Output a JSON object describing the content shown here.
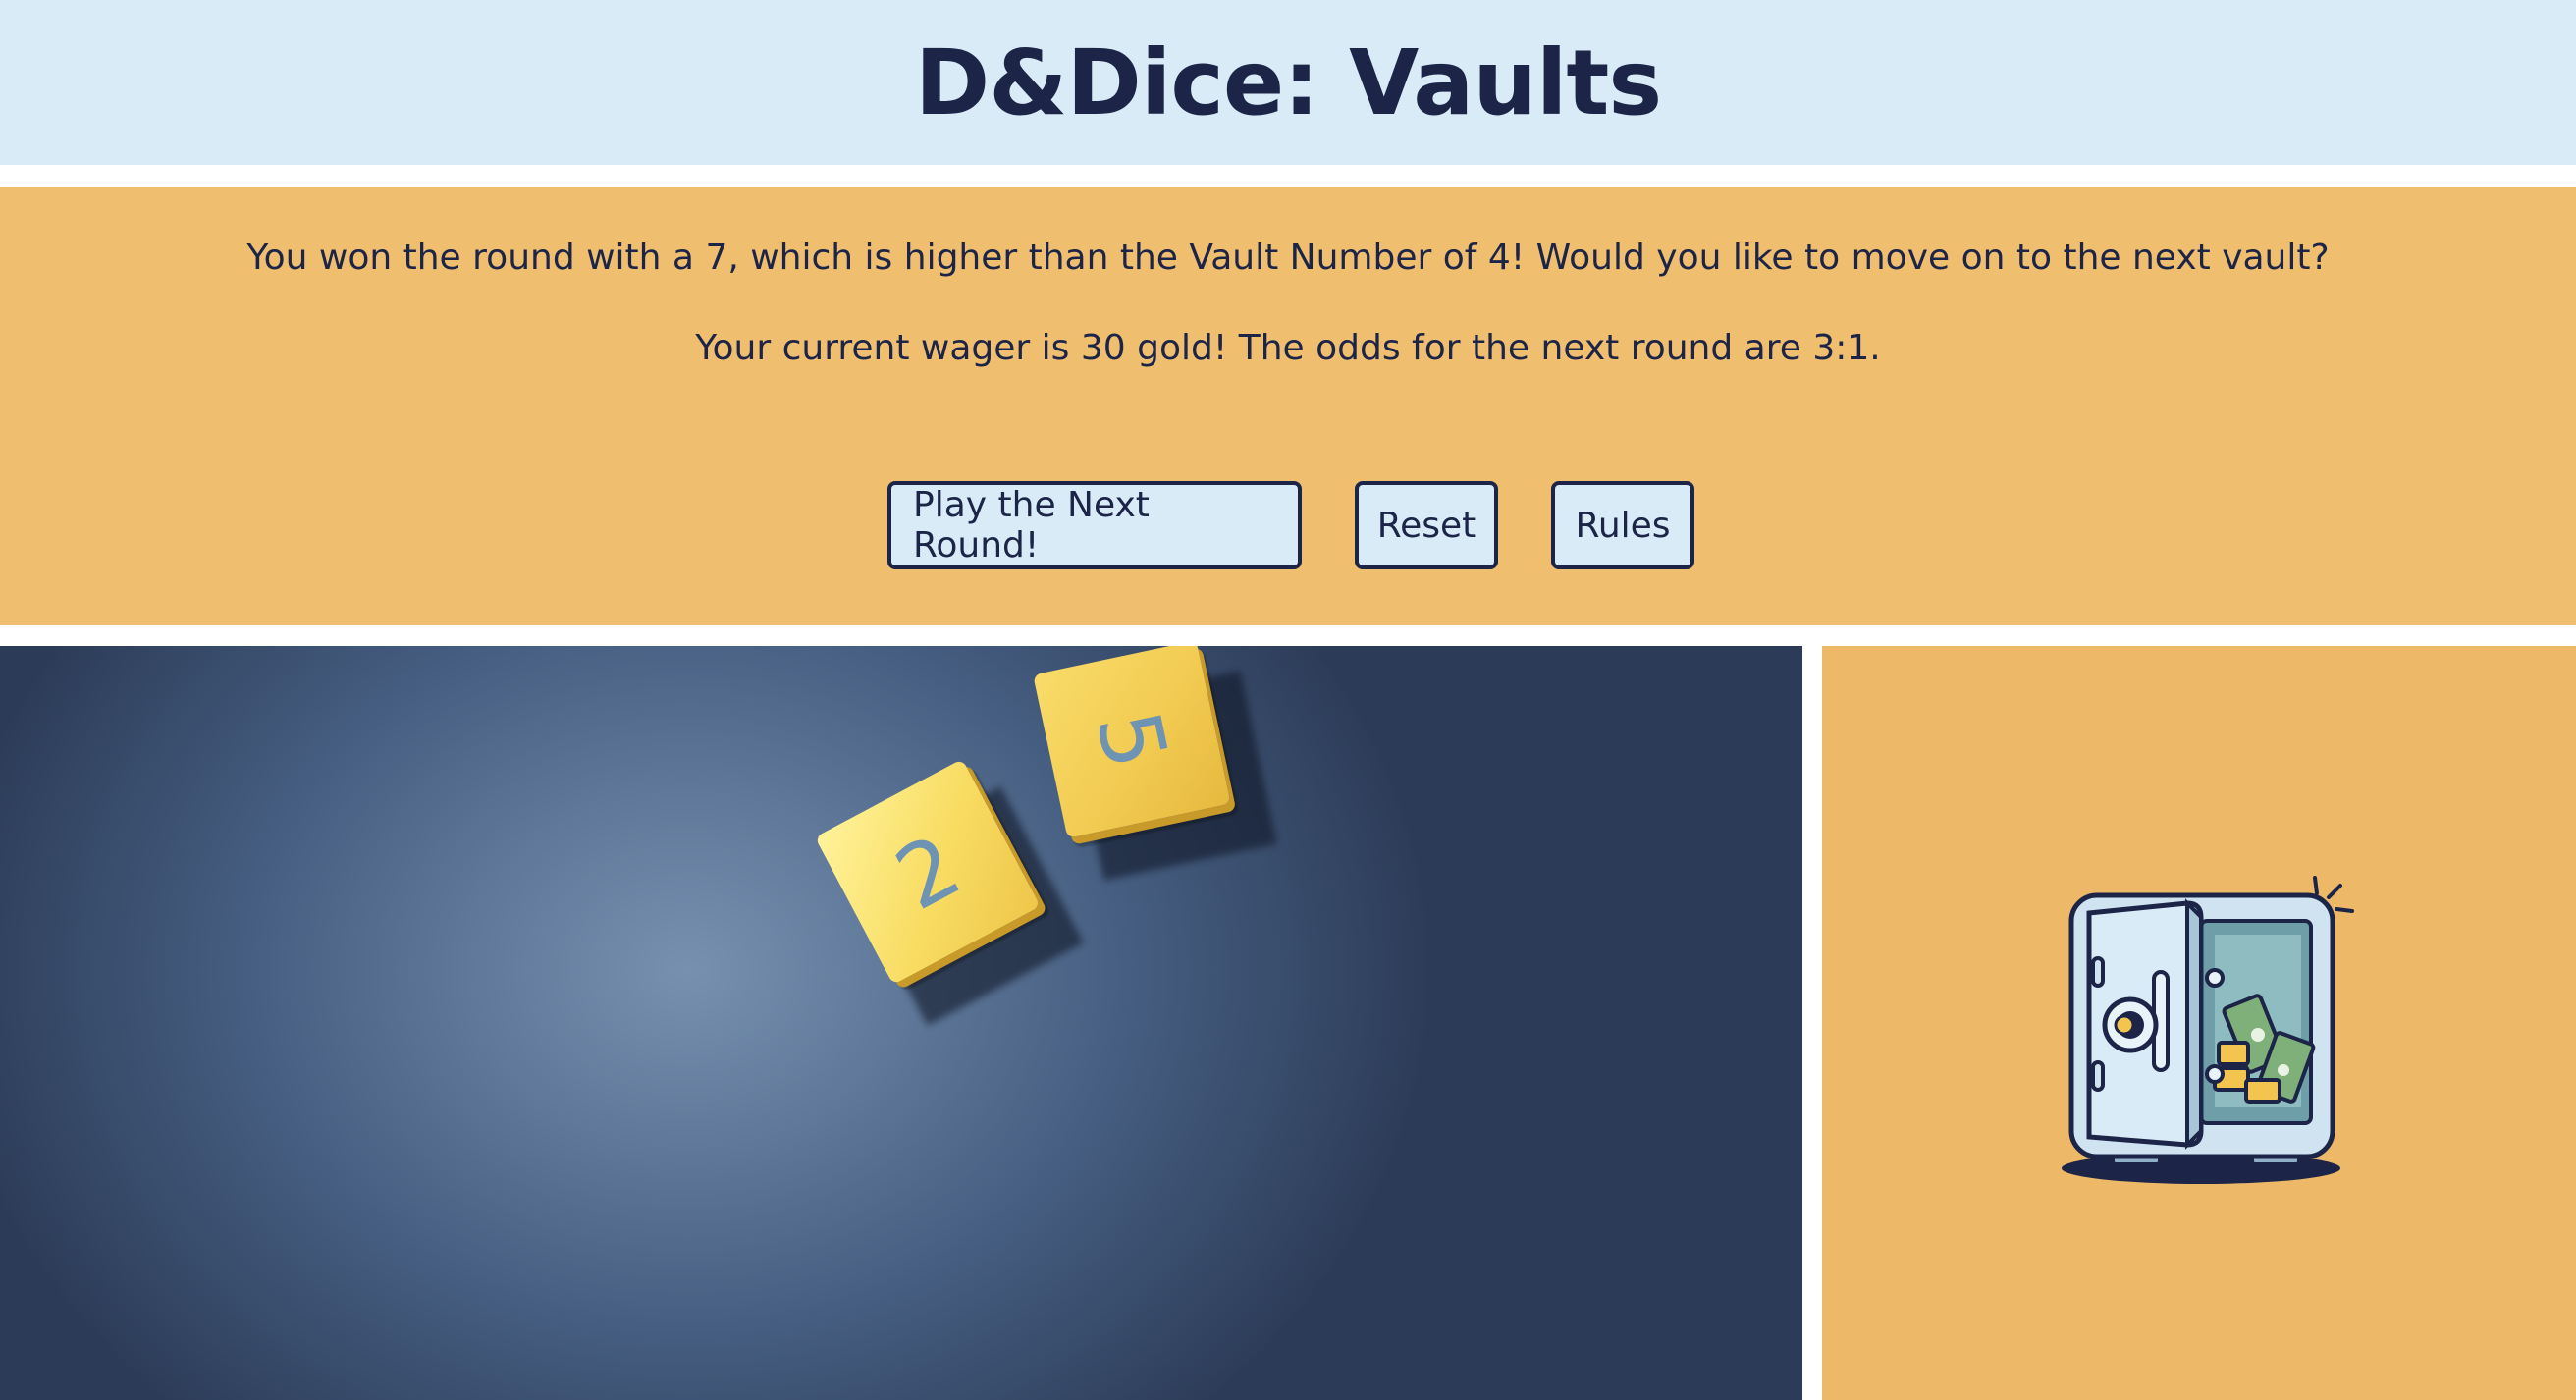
{
  "header": {
    "title": "D&Dice: Vaults"
  },
  "panel": {
    "message": "You won the round with a 7, which is higher than the Vault Number of 4! Would you like to move on to the next vault?",
    "wager": "Your current wager is 30 gold! The odds for the next round are 3:1.",
    "buttons": {
      "next": "Play the Next Round!",
      "reset": "Reset",
      "rules": "Rules"
    }
  },
  "dice": [
    {
      "value": "2"
    },
    {
      "value": "5"
    }
  ],
  "colors": {
    "header_bg": "#d8ebf6",
    "panel_bg": "#f0be6f",
    "text": "#1c2447",
    "die_face": "#f7d65a",
    "die_number": "#6e93b3",
    "table_bg": "#4a6285"
  }
}
